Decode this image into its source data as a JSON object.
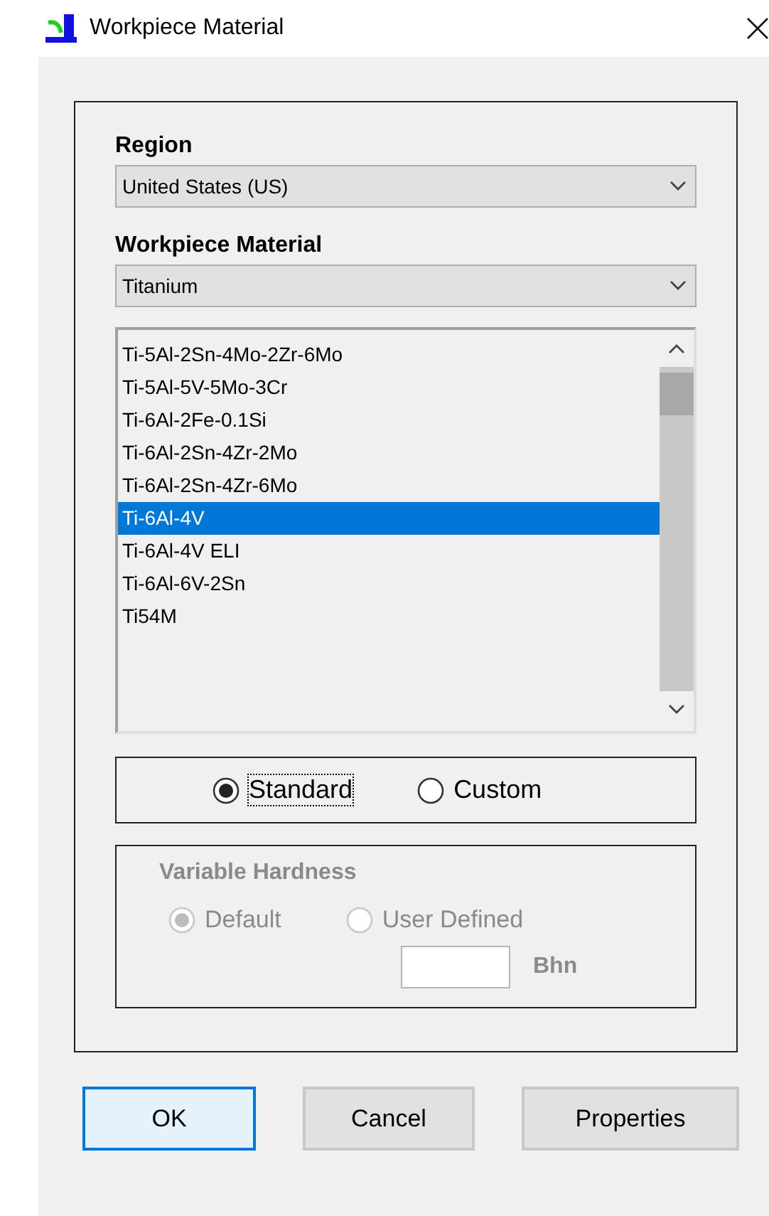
{
  "window": {
    "title": "Workpiece Material"
  },
  "region": {
    "label": "Region",
    "value": "United States (US)"
  },
  "material": {
    "label": "Workpiece Material",
    "value": "Titanium"
  },
  "grades": [
    {
      "label": "Ti-5Al-2Sn-4Mo-2Zr-6Mo",
      "selected": false
    },
    {
      "label": "Ti-5Al-5V-5Mo-3Cr",
      "selected": false
    },
    {
      "label": "Ti-6Al-2Fe-0.1Si",
      "selected": false
    },
    {
      "label": "Ti-6Al-2Sn-4Zr-2Mo",
      "selected": false
    },
    {
      "label": "Ti-6Al-2Sn-4Zr-6Mo",
      "selected": false
    },
    {
      "label": "Ti-6Al-4V",
      "selected": true
    },
    {
      "label": "Ti-6Al-4V ELI",
      "selected": false
    },
    {
      "label": "Ti-6Al-6V-2Sn",
      "selected": false
    },
    {
      "label": "Ti54M",
      "selected": false
    }
  ],
  "mode": [
    {
      "label": "Standard",
      "selected": true,
      "focused": true
    },
    {
      "label": "Custom",
      "selected": false,
      "focused": false
    }
  ],
  "hardness": {
    "title": "Variable Hardness",
    "disabled": true,
    "options": [
      {
        "label": "Default",
        "selected": true
      },
      {
        "label": "User Defined",
        "selected": false
      }
    ],
    "unit": "Bhn"
  },
  "buttons": [
    {
      "label": "OK",
      "default": true
    },
    {
      "label": "Cancel",
      "default": false
    },
    {
      "label": "Properties",
      "default": false
    }
  ]
}
